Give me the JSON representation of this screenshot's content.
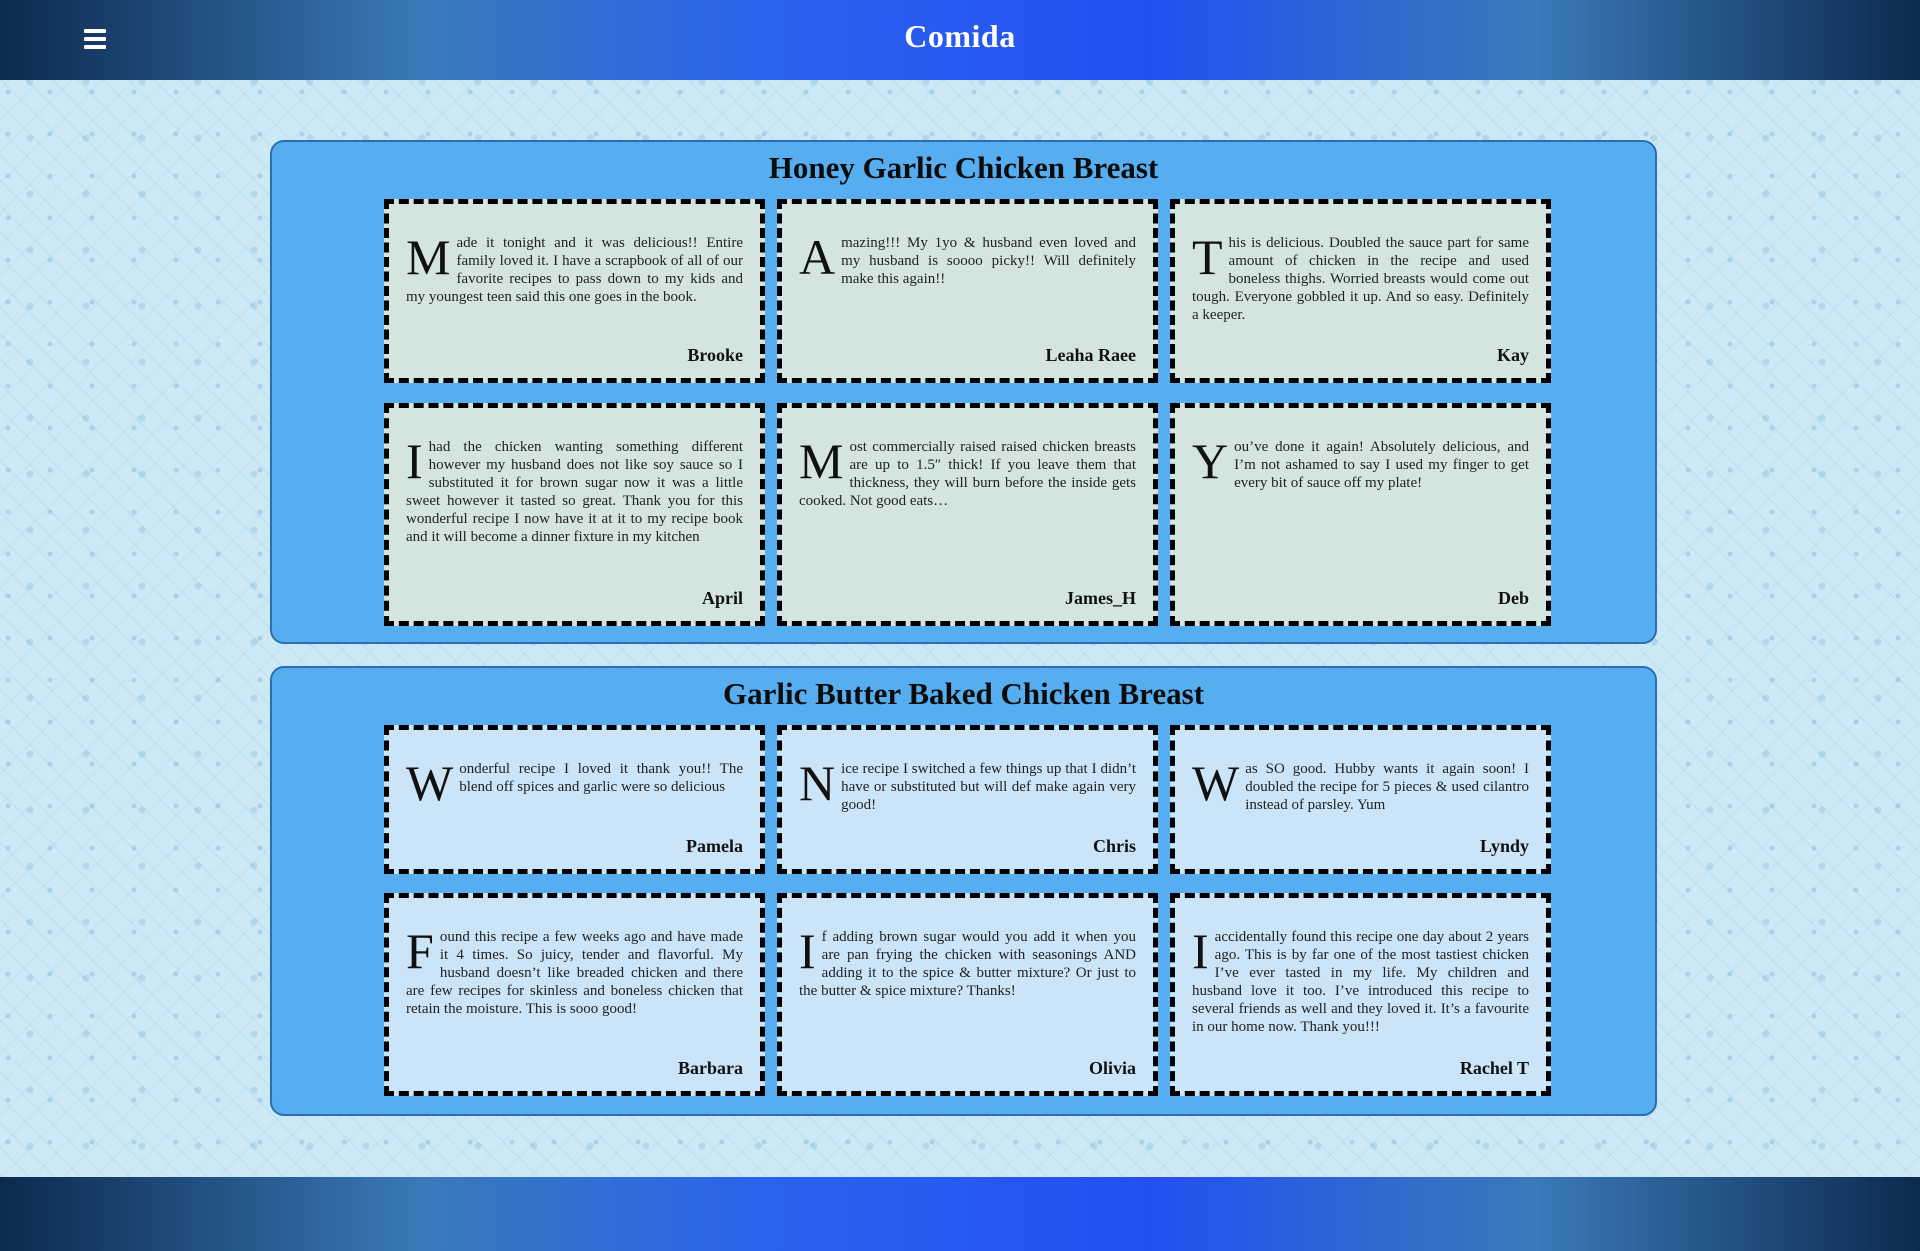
{
  "header": {
    "title": "Comida",
    "menu_icon": "hamburger-menu-icon"
  },
  "sections": [
    {
      "title": "Honey Garlic Chicken Breast",
      "reviews": [
        {
          "initial": "M",
          "text": "ade it tonight and it was delicious!! Entire family loved it. I have a scrapbook of all of our favorite recipes to pass down to my kids and my youngest teen said this one goes in the book.",
          "author": "Brooke"
        },
        {
          "initial": "A",
          "text": "mazing!!! My 1yo & husband even loved and my husband is soooo picky!! Will definitely make this again!!",
          "author": "Leaha Raee"
        },
        {
          "initial": "T",
          "text": "his is delicious. Doubled the sauce part for same amount of chicken in the recipe and used boneless thighs. Worried breasts would come out tough. Everyone gobbled it up. And so easy. Definitely a keeper.",
          "author": "Kay"
        },
        {
          "initial": "I",
          "text": "had the chicken wanting something different however my husband does not like soy sauce so I substituted it for brown sugar now it was a little sweet however it tasted so great. Thank you for this wonderful recipe I now have it at it to my recipe book and it will become a dinner fixture in my kitchen",
          "author": "April"
        },
        {
          "initial": "M",
          "text": "ost commercially raised raised chicken breasts are up to 1.5″ thick! If you leave them that thickness, they will burn before the inside gets cooked. Not good eats…",
          "author": "James_H"
        },
        {
          "initial": "Y",
          "text": "ou’ve done it again! Absolutely delicious, and I’m not ashamed to say I used my finger to get every bit of sauce off my plate!",
          "author": "Deb"
        }
      ]
    },
    {
      "title": "Garlic Butter Baked Chicken Breast",
      "reviews": [
        {
          "initial": "W",
          "text": "onderful recipe I loved it thank you!! The blend off spices and garlic were so delicious",
          "author": "Pamela"
        },
        {
          "initial": "N",
          "text": "ice recipe I switched a few things up that I didn’t have or substituted but will def make again very good!",
          "author": "Chris"
        },
        {
          "initial": "W",
          "text": "as SO good. Hubby wants it again soon! I doubled the recipe for 5 pieces & used cilantro instead of parsley. Yum",
          "author": "Lyndy"
        },
        {
          "initial": "F",
          "text": "ound this recipe a few weeks ago and have made it 4 times. So juicy, tender and flavorful. My husband doesn’t like breaded chicken and there are few recipes for skinless and boneless chicken that retain the moisture. This is sooo good!",
          "author": "Barbara"
        },
        {
          "initial": "I",
          "text": "f adding brown sugar would you add it when you are pan frying the chicken with seasonings AND adding it to the spice & butter mixture? Or just to the butter & spice mixture? Thanks!",
          "author": "Olivia"
        },
        {
          "initial": "I",
          "text": " accidentally found this recipe one day about 2 years ago. This is by far one of the most tastiest chicken I’ve ever tasted in my life. My children and husband love it too. I’ve introduced this recipe to several friends as well and they loved it. It’s a favourite in our home now. Thank you!!!",
          "author": "Rachel T"
        }
      ]
    }
  ]
}
